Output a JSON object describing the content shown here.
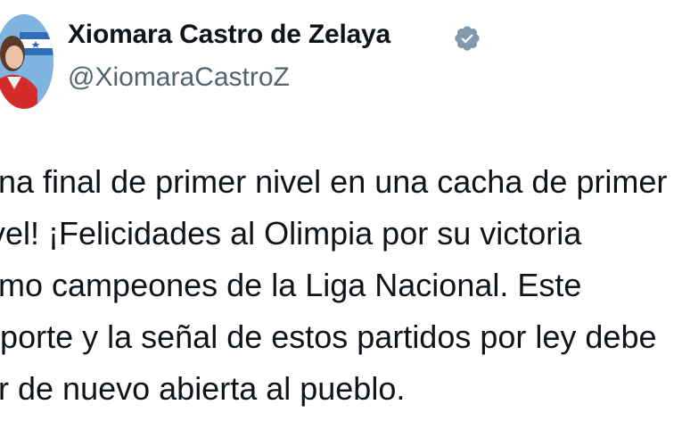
{
  "author": {
    "name": "Xiomara Castro de Zelaya",
    "handle": "@XiomaraCastroZ",
    "avatar_icon": "profile-photo",
    "verified_icon": "verified-badge-icon",
    "verified_color": "#829aab"
  },
  "tweet": {
    "lines": [
      "¡Una final de primer nivel en una cacha de primer",
      "nivel! ¡Felicidades al Olimpia por su victoria",
      "como campeones de la Liga Nacional. Este",
      "deporte y la señal de estos partidos por ley debe",
      "ser de nuevo abierta al pueblo."
    ]
  },
  "colors": {
    "text": "#0f1419",
    "handle": "#536471",
    "avatar_bg": "#6fa8dc",
    "jacket": "#d62b2b"
  }
}
